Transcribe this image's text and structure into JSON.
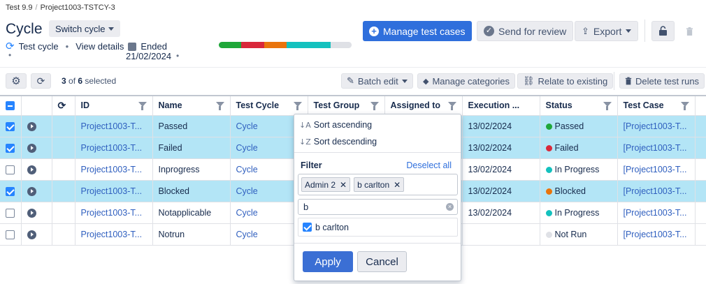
{
  "breadcrumb": {
    "parent": "Test 9.9",
    "current": "Project1003-TSTCY-3"
  },
  "header": {
    "title": "Cycle",
    "switch_label": "Switch cycle",
    "cycle_type": "Test cycle",
    "view_details": "View details",
    "ended_label": "Ended",
    "ended_date": "21/02/2024"
  },
  "progress": [
    {
      "status": "Passed",
      "fraction": 0.17,
      "color": "#1fa739"
    },
    {
      "status": "Failed",
      "fraction": 0.17,
      "color": "#d9283a"
    },
    {
      "status": "Blocked",
      "fraction": 0.17,
      "color": "#e9740c"
    },
    {
      "status": "In Progress",
      "fraction": 0.33,
      "color": "#14c1be"
    },
    {
      "status": "Not Run",
      "fraction": 0.16,
      "color": "#dfe1e6"
    }
  ],
  "actions": {
    "manage": "Manage test cases",
    "review": "Send for review",
    "export": "Export"
  },
  "toolbar": {
    "selected_count": "3",
    "total_count": "6",
    "of": "of",
    "selected_suffix": "selected",
    "batch_edit": "Batch edit",
    "manage_categories": "Manage categories",
    "relate": "Relate to existing",
    "delete": "Delete test runs"
  },
  "table": {
    "columns": [
      "ID",
      "Name",
      "Test Cycle",
      "Test Group",
      "Assigned to",
      "Execution ...",
      "Status",
      "Test Case"
    ],
    "rows": [
      {
        "selected": true,
        "id": "Project1003-T...",
        "name": "Passed",
        "cycle": "Cycle",
        "execution": "13/02/2024",
        "status": "Passed",
        "status_color": "#1fa739",
        "testcase": "[Project1003-T..."
      },
      {
        "selected": true,
        "id": "Project1003-T...",
        "name": "Failed",
        "cycle": "Cycle",
        "execution": "13/02/2024",
        "status": "Failed",
        "status_color": "#d9283a",
        "testcase": "[Project1003-T..."
      },
      {
        "selected": false,
        "id": "Project1003-T...",
        "name": "Inprogress",
        "cycle": "Cycle",
        "execution": "13/02/2024",
        "status": "In Progress",
        "status_color": "#14c1be",
        "testcase": "[Project1003-T..."
      },
      {
        "selected": true,
        "id": "Project1003-T...",
        "name": "Blocked",
        "cycle": "Cycle",
        "execution": "13/02/2024",
        "status": "Blocked",
        "status_color": "#e9740c",
        "testcase": "[Project1003-T..."
      },
      {
        "selected": false,
        "id": "Project1003-T...",
        "name": "Notapplicable",
        "cycle": "Cycle",
        "execution": "13/02/2024",
        "status": "In Progress",
        "status_color": "#14c1be",
        "testcase": "[Project1003-T..."
      },
      {
        "selected": false,
        "id": "Project1003-T...",
        "name": "Notrun",
        "cycle": "Cycle",
        "execution": "",
        "status": "Not Run",
        "status_color": "#dfe1e6",
        "testcase": "[Project1003-T..."
      }
    ]
  },
  "dropdown": {
    "sort_asc": "Sort ascending",
    "sort_desc": "Sort descending",
    "filter_label": "Filter",
    "deselect_all": "Deselect all",
    "tags": [
      "Admin 2",
      "b carlton"
    ],
    "search_value": "b",
    "option": "b carlton",
    "apply": "Apply",
    "cancel": "Cancel"
  }
}
